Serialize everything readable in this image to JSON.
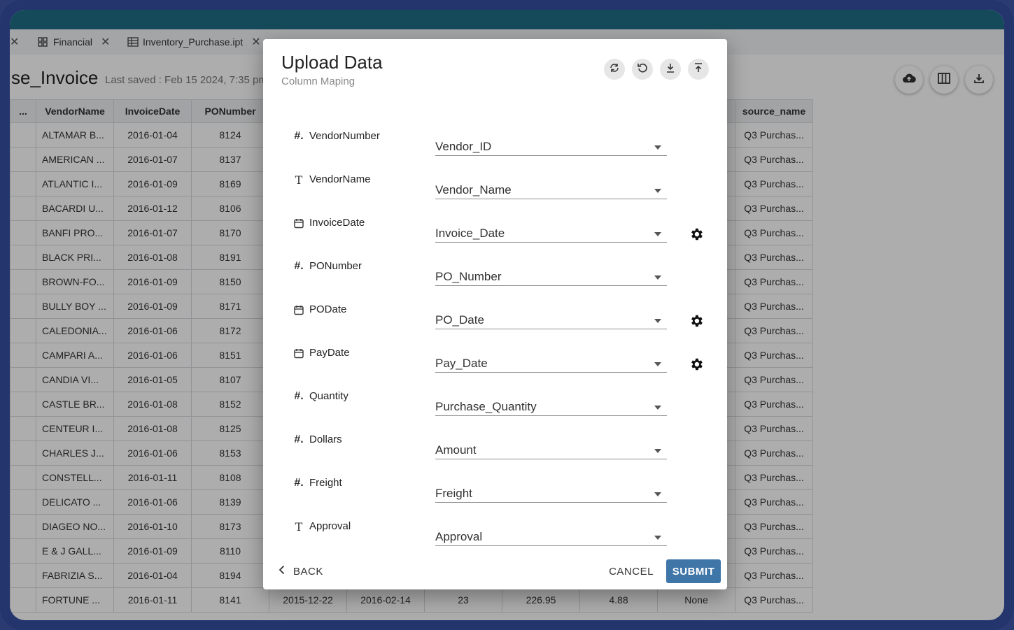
{
  "tabs": [
    {
      "label": "",
      "closable": true
    },
    {
      "label": "Financial",
      "icon": "dashboard-icon",
      "closable": true
    },
    {
      "label": "Inventory_Purchase.ipt",
      "icon": "table-icon",
      "closable": true
    }
  ],
  "document": {
    "title": "se_Invoice",
    "last_saved": "Last saved : Feb 15 2024, 7:35 pm"
  },
  "toolbar_icons": [
    "cloud-upload-icon",
    "columns-icon",
    "download-icon"
  ],
  "grid": {
    "columns": [
      "...",
      "VendorName",
      "InvoiceDate",
      "PONumber",
      "source_name"
    ],
    "rows": [
      [
        "",
        "ALTAMAR B...",
        "2016-01-04",
        "8124",
        "Q3 Purchas..."
      ],
      [
        "",
        "AMERICAN ...",
        "2016-01-07",
        "8137",
        "Q3 Purchas..."
      ],
      [
        "",
        "ATLANTIC I...",
        "2016-01-09",
        "8169",
        "Q3 Purchas..."
      ],
      [
        "",
        "BACARDI U...",
        "2016-01-12",
        "8106",
        "Q3 Purchas..."
      ],
      [
        "",
        "BANFI PRO...",
        "2016-01-07",
        "8170",
        "Q3 Purchas..."
      ],
      [
        "",
        "BLACK PRI...",
        "2016-01-08",
        "8191",
        "Q3 Purchas..."
      ],
      [
        "",
        "BROWN-FO...",
        "2016-01-09",
        "8150",
        "Q3 Purchas..."
      ],
      [
        "",
        "BULLY BOY ...",
        "2016-01-09",
        "8171",
        "Q3 Purchas..."
      ],
      [
        "",
        "CALEDONIA...",
        "2016-01-06",
        "8172",
        "Q3 Purchas..."
      ],
      [
        "",
        "CAMPARI A...",
        "2016-01-06",
        "8151",
        "Q3 Purchas..."
      ],
      [
        "",
        "CANDIA VI...",
        "2016-01-05",
        "8107",
        "Q3 Purchas..."
      ],
      [
        "",
        "CASTLE BR...",
        "2016-01-08",
        "8152",
        "Q3 Purchas..."
      ],
      [
        "",
        "CENTEUR I...",
        "2016-01-08",
        "8125",
        "Q3 Purchas..."
      ],
      [
        "",
        "CHARLES J...",
        "2016-01-06",
        "8153",
        "Q3 Purchas..."
      ],
      [
        "",
        "CONSTELL...",
        "2016-01-11",
        "8108",
        "Q3 Purchas..."
      ],
      [
        "",
        "DELICATO ...",
        "2016-01-06",
        "8139",
        "Q3 Purchas..."
      ],
      [
        "",
        "DIAGEO NO...",
        "2016-01-10",
        "8173",
        "Q3 Purchas..."
      ],
      [
        "",
        "E & J GALL...",
        "2016-01-09",
        "8110",
        "Q3 Purchas..."
      ],
      [
        "",
        "FABRIZIA S...",
        "2016-01-04",
        "8194",
        "Q3 Purchas..."
      ]
    ],
    "last_row": [
      "",
      "FORTUNE ...",
      "2016-01-11",
      "8141",
      "2015-12-22",
      "2016-02-14",
      "23",
      "226.95",
      "4.88",
      "None",
      "Q3 Purchas..."
    ]
  },
  "dialog": {
    "title": "Upload Data",
    "subtitle": "Column Maping",
    "header_icons": [
      "sync-icon",
      "undo-icon",
      "download-icon",
      "upload-icon"
    ],
    "mappings": [
      {
        "type": "number",
        "field": "VendorNumber",
        "value": "Vendor_ID",
        "settings": false
      },
      {
        "type": "text",
        "field": "VendorName",
        "value": "Vendor_Name",
        "settings": false
      },
      {
        "type": "date",
        "field": "InvoiceDate",
        "value": "Invoice_Date",
        "settings": true
      },
      {
        "type": "number",
        "field": "PONumber",
        "value": "PO_Number",
        "settings": false
      },
      {
        "type": "date",
        "field": "PODate",
        "value": "PO_Date",
        "settings": true
      },
      {
        "type": "date",
        "field": "PayDate",
        "value": "Pay_Date",
        "settings": true
      },
      {
        "type": "number",
        "field": "Quantity",
        "value": "Purchase_Quantity",
        "settings": false
      },
      {
        "type": "number",
        "field": "Dollars",
        "value": "Amount",
        "settings": false
      },
      {
        "type": "number",
        "field": "Freight",
        "value": "Freight",
        "settings": false
      },
      {
        "type": "text",
        "field": "Approval",
        "value": "Approval",
        "settings": false
      }
    ],
    "back_label": "BACK",
    "cancel_label": "CANCEL",
    "submit_label": "SUBMIT"
  },
  "colors": {
    "frame": "#24356e",
    "topbar": "#1f6e86",
    "submit": "#3f76a8"
  }
}
